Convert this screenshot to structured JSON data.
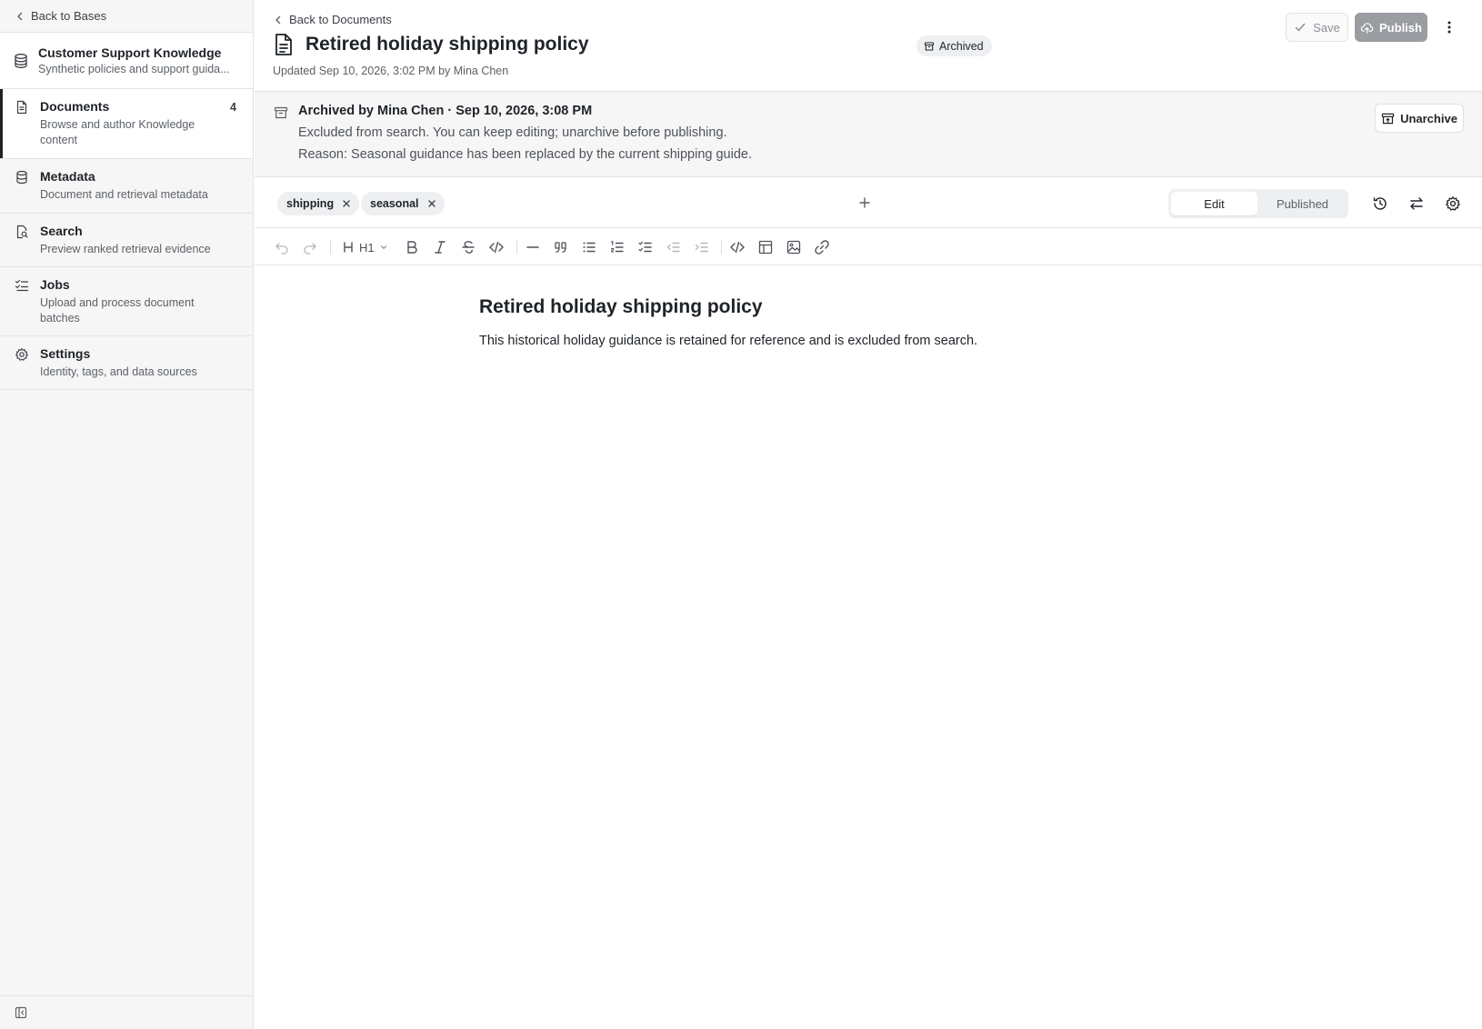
{
  "sidebar": {
    "back_label": "Back to Bases",
    "base": {
      "title": "Customer Support Knowledge",
      "subtitle": "Synthetic policies and support guida..."
    },
    "items": [
      {
        "title": "Documents",
        "desc": "Browse and author Knowledge content",
        "count": "4",
        "active": true,
        "icon": "document-icon"
      },
      {
        "title": "Metadata",
        "desc": "Document and retrieval metadata",
        "icon": "database-icon"
      },
      {
        "title": "Search",
        "desc": "Preview ranked retrieval evidence",
        "icon": "search-doc-icon"
      },
      {
        "title": "Jobs",
        "desc": "Upload and process document batches",
        "icon": "checklist-icon"
      },
      {
        "title": "Settings",
        "desc": "Identity, tags, and data sources",
        "icon": "gear-icon"
      }
    ]
  },
  "header": {
    "back_label": "Back to Documents",
    "title": "Retired holiday shipping policy",
    "updated": "Updated Sep 10, 2026, 3:02 PM by Mina Chen",
    "status_badge": "Archived",
    "save_label": "Save",
    "publish_label": "Publish"
  },
  "banner": {
    "title": "Archived by Mina Chen · Sep 10, 2026, 3:08 PM",
    "line1": "Excluded from search. You can keep editing; unarchive before publishing.",
    "line2": "Reason: Seasonal guidance has been replaced by the current shipping guide.",
    "unarchive_label": "Unarchive"
  },
  "tags": [
    "shipping",
    "seasonal"
  ],
  "mode_toggle": {
    "edit": "Edit",
    "published": "Published",
    "selected": "Edit"
  },
  "toolbar": {
    "heading_value": "H1"
  },
  "editor": {
    "heading": "Retired holiday shipping policy",
    "paragraph": "This historical holiday guidance is retained for reference and is excluded from search."
  },
  "colors": {
    "active_indicator": "#1f2328",
    "sidebar_bg": "#f6f6f6",
    "publish_disabled": "#9a9da1"
  }
}
